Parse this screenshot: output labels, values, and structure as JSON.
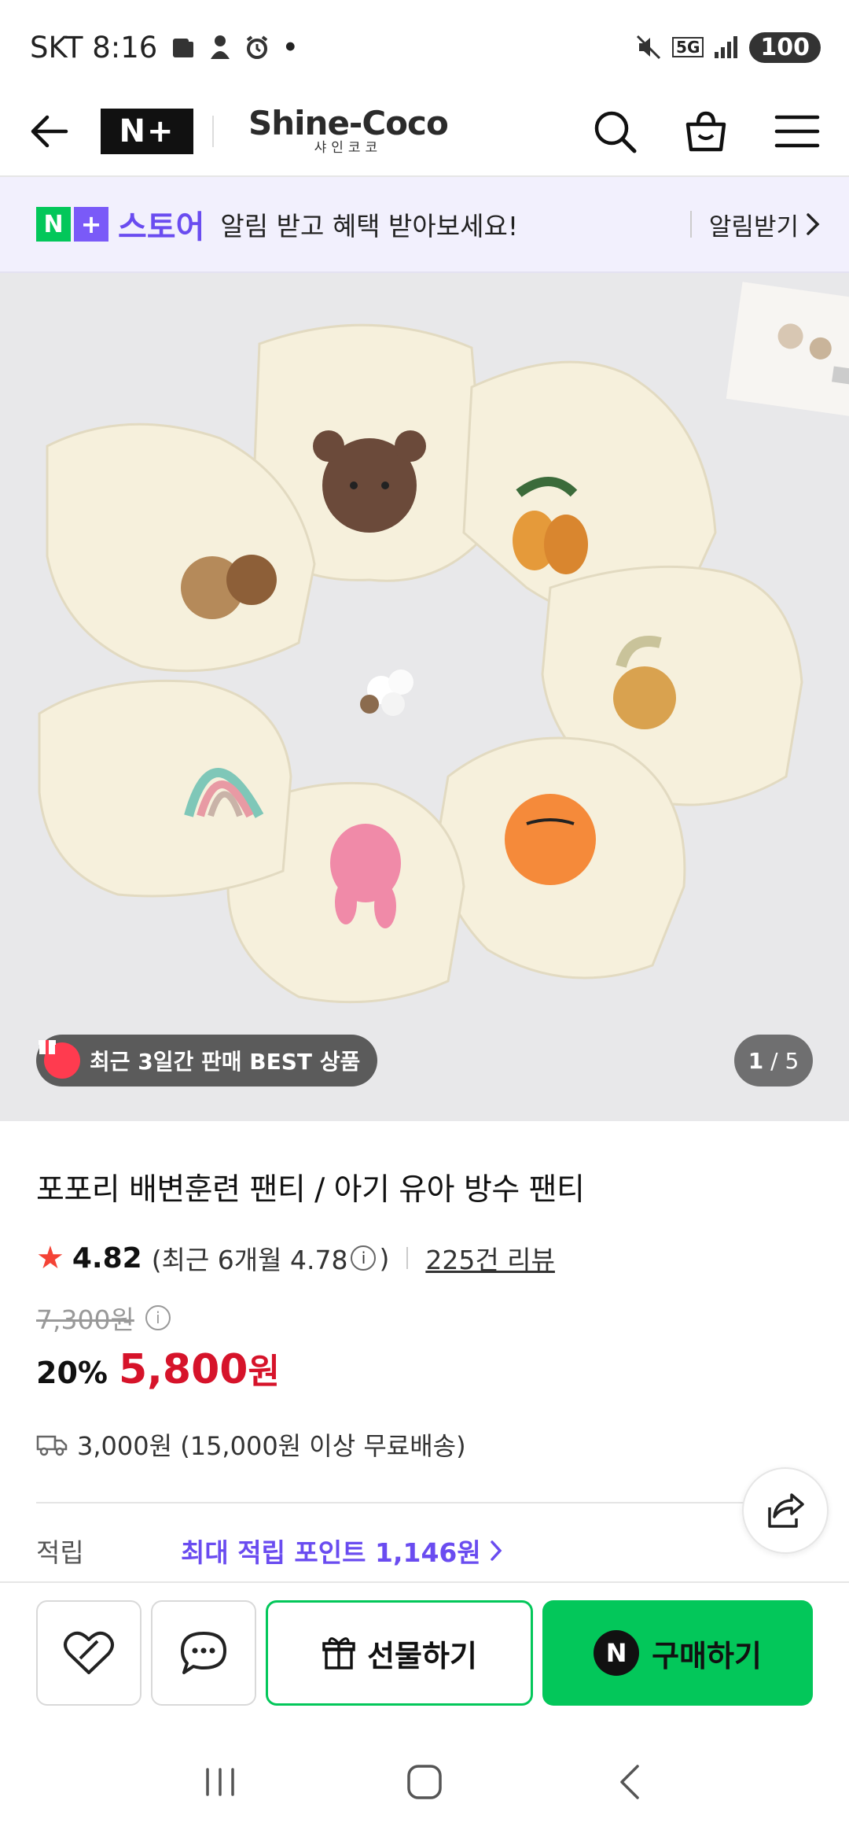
{
  "status_bar": {
    "carrier_time": "SKT 8:16",
    "dot": "•",
    "network": "5G",
    "battery": "100"
  },
  "header": {
    "logo_text": "N+",
    "brand_name": "Shine-Coco",
    "brand_sub": "샤인코코"
  },
  "store_banner": {
    "logo_n": "N",
    "logo_plus": "+",
    "store_name": "스토어",
    "message": "알림 받고 혜택 받아보세요!",
    "cta": "알림받기"
  },
  "hero": {
    "best_badge": "최근 3일간 판매 BEST 상품",
    "page_current": "1",
    "page_total": "/ 5"
  },
  "product": {
    "title": "포포리 배변훈련 팬티 / 아기 유아 방수 팬티",
    "rating": "4.82",
    "recent_rating_prefix": "(최근 6개월 4.78",
    "recent_rating_suffix": ")",
    "reviews": "225건 리뷰",
    "original_price": "7,300원",
    "discount": "20%",
    "sale_price": "5,800",
    "sale_unit": "원",
    "shipping": "3,000원 (15,000원 이상 무료배송)",
    "points_label": "적립",
    "points_value": "최대 적립 포인트 1,146원"
  },
  "actions": {
    "gift": "선물하기",
    "buy_logo": "N",
    "buy": "구매하기"
  },
  "colors": {
    "naver_green": "#03c75a",
    "store_purple": "#6a4cf0",
    "price_red": "#d6132a"
  }
}
